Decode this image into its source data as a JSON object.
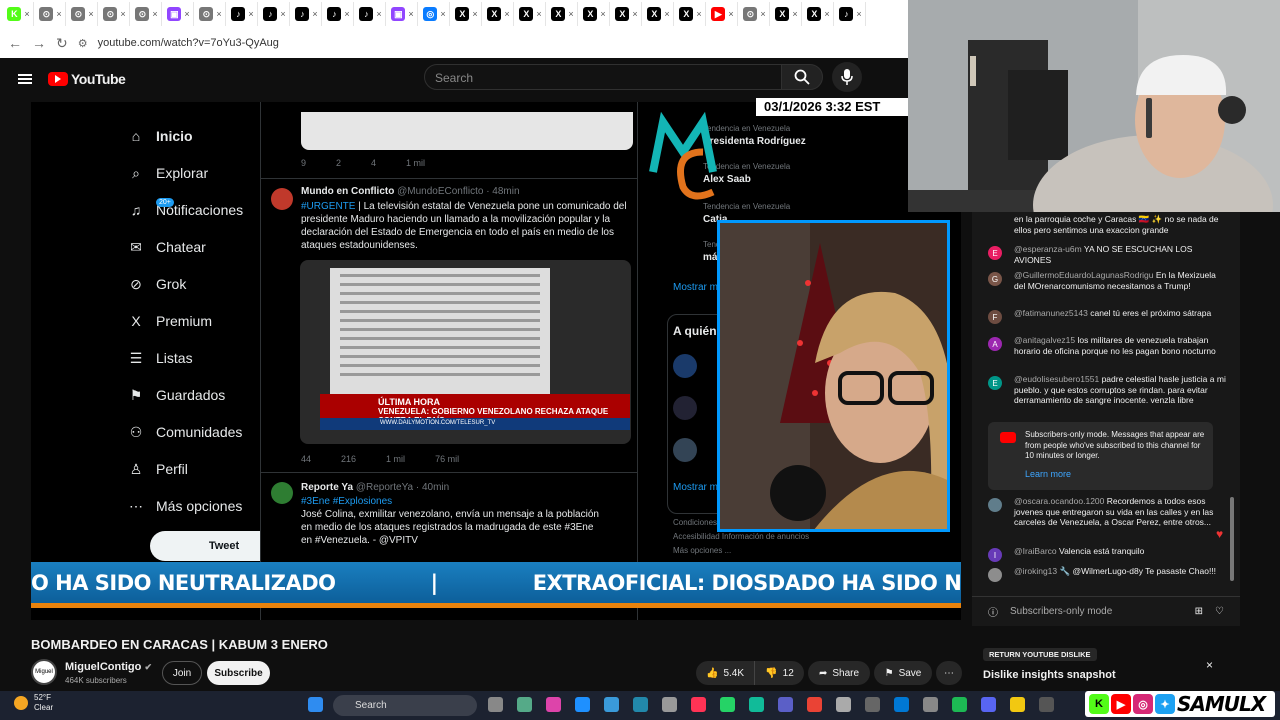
{
  "browser": {
    "tabs": [
      {
        "icon": "kick-icon",
        "color": "#53fc18",
        "letter": "K"
      },
      {
        "icon": "chrome-icon",
        "color": "#777",
        "letter": "⊙"
      },
      {
        "icon": "chrome-icon",
        "color": "#777",
        "letter": "⊙"
      },
      {
        "icon": "chrome-icon",
        "color": "#777",
        "letter": "⊙"
      },
      {
        "icon": "chrome-icon",
        "color": "#777",
        "letter": "⊙"
      },
      {
        "icon": "twitch-icon",
        "color": "#9146ff",
        "letter": "▣"
      },
      {
        "icon": "chrome-icon",
        "color": "#777",
        "letter": "⊙"
      },
      {
        "icon": "tiktok-icon",
        "color": "#000",
        "letter": "♪"
      },
      {
        "icon": "tiktok-icon",
        "color": "#000",
        "letter": "♪"
      },
      {
        "icon": "tiktok-icon",
        "color": "#000",
        "letter": "♪"
      },
      {
        "icon": "tiktok-icon",
        "color": "#000",
        "letter": "♪"
      },
      {
        "icon": "tiktok-icon",
        "color": "#000",
        "letter": "♪"
      },
      {
        "icon": "twitch-icon",
        "color": "#9146ff",
        "letter": "▣"
      },
      {
        "icon": "messenger-icon",
        "color": "#0a7cff",
        "letter": "◎"
      },
      {
        "icon": "x-icon",
        "color": "#000",
        "letter": "X"
      },
      {
        "icon": "x-icon",
        "color": "#000",
        "letter": "X"
      },
      {
        "icon": "x-icon",
        "color": "#000",
        "letter": "X"
      },
      {
        "icon": "x-icon",
        "color": "#000",
        "letter": "X"
      },
      {
        "icon": "x-icon",
        "color": "#000",
        "letter": "X"
      },
      {
        "icon": "x-icon",
        "color": "#000",
        "letter": "X"
      },
      {
        "icon": "x-icon",
        "color": "#000",
        "letter": "X"
      },
      {
        "icon": "x-icon",
        "color": "#000",
        "letter": "X"
      },
      {
        "icon": "youtube-icon",
        "color": "#f00",
        "letter": "▶"
      },
      {
        "icon": "chrome-icon",
        "color": "#777",
        "letter": "⊙"
      },
      {
        "icon": "x-icon",
        "color": "#000",
        "letter": "X"
      },
      {
        "icon": "x-icon",
        "color": "#000",
        "letter": "X"
      },
      {
        "icon": "tiktok-icon",
        "color": "#000",
        "letter": "♪"
      }
    ],
    "url": "youtube.com/watch?v=7oYu3-QyAug"
  },
  "youtube": {
    "logo_text": "YouTube",
    "search_placeholder": "Search"
  },
  "video": {
    "x_nav": [
      {
        "icon": "home-icon",
        "glyph": "⌂",
        "label": "Inicio",
        "bold": true
      },
      {
        "icon": "search-icon",
        "glyph": "⌕",
        "label": "Explorar"
      },
      {
        "icon": "bell-icon",
        "glyph": "♫",
        "label": "Notificaciones"
      },
      {
        "icon": "mail-icon",
        "glyph": "✉",
        "label": "Chatear"
      },
      {
        "icon": "grok-icon",
        "glyph": "⊘",
        "label": "Grok"
      },
      {
        "icon": "x-icon",
        "glyph": "X",
        "label": "Premium"
      },
      {
        "icon": "list-icon",
        "glyph": "☰",
        "label": "Listas"
      },
      {
        "icon": "bookmark-icon",
        "glyph": "⚑",
        "label": "Guardados"
      },
      {
        "icon": "people-icon",
        "glyph": "⚇",
        "label": "Comunidades"
      },
      {
        "icon": "person-icon",
        "glyph": "♙",
        "label": "Perfil"
      },
      {
        "icon": "more-icon",
        "glyph": "⋯",
        "label": "Más opciones"
      }
    ],
    "notif_badge": "20+",
    "tweet_button": "Tweet",
    "tweet0_actions": [
      "9",
      "2",
      "4",
      "1 mil"
    ],
    "tweet1": {
      "name": "Mundo en Conflicto",
      "handle": "@MundoEConflicto · 48min",
      "hashtag": "#URGENTE",
      "text": "| La televisión estatal de Venezuela pone un comunicado del presidente Maduro haciendo un llamado a la movilización popular y la declaración del Estado de Emergencia en todo el país en medio de los ataques estadounidenses.",
      "banner_label": "ÚLTIMA HORA",
      "banner_text": "VENEZUELA: GOBIERNO VENEZOLANO RECHAZA ATAQUE CONTRA EL PAÍS",
      "strip": "WWW.DAILYMOTION.COM/TELESUR_TV",
      "actions": [
        "44",
        "216",
        "1 mil",
        "76 mil"
      ]
    },
    "tweet2": {
      "name": "Reporte Ya",
      "handle": "@ReporteYa · 40min",
      "hashtags": "#3Ene #Explosiones",
      "text": "José Colina, exmilitar venezolano, envía un mensaje a la población en medio de los ataques registrados la madrugada de este #3Ene en #Venezuela. - @VPITV"
    },
    "trends": [
      {
        "small": "Tendencia en Venezuela",
        "big": "Presidenta Rodríguez"
      },
      {
        "small": "Tendencia en Venezuela",
        "big": "Alex Saab"
      },
      {
        "small": "Tendencia en Venezuela",
        "big": "Catia"
      },
      {
        "small": "Tendencia",
        "big": "más de 1..."
      }
    ],
    "mostrar": "Mostrar m...",
    "aquien": "A quién",
    "footer_links": "Condiciones de... Política de cookies Accesibilidad Información de anuncios Más opciones ...",
    "datetime": "03/1/2026 3:32 EST",
    "ticker_left": "O HA SIDO NEUTRALIZADO",
    "ticker_divider": "|",
    "ticker_right": "EXTRAOFICIAL: DIOSDADO HA SIDO NEUTRALIZADO"
  },
  "meta": {
    "title": "BOMBARDEO EN CARACAS | KABUM 3 ENERO",
    "channel": "MiguelContigo",
    "avatar_text": "Miguel",
    "subscribers": "464K subscribers",
    "join": "Join",
    "subscribe": "Subscribe",
    "likes": "5.4K",
    "dislikes": "12",
    "share": "Share",
    "save": "Save"
  },
  "chat": {
    "messages": [
      {
        "author": "",
        "text": "en la parroquia coche y Caracas 🇻🇪 ✨ no se nada de ellos pero sentimos una exaccion grande",
        "avatar": "",
        "color": "#e91e63"
      },
      {
        "author": "@esperanza-u6m",
        "text": "YA NO SE ESCUCHAN LOS AVIONES",
        "avatar": "E",
        "color": "#e91e63"
      },
      {
        "author": "@GuillermoEduardoLagunasRodrigu",
        "text": "En la Mexizuela del MOrenarcomunismo necesitamos a Trump!",
        "avatar": "G",
        "color": "#795548"
      },
      {
        "author": "@fatimanunez5143",
        "text": "canel tú eres el próximo sátrapa",
        "avatar": "F",
        "color": "#6d4c41"
      },
      {
        "author": "@anitagalvez15",
        "text": "los militares de venezuela trabajan horario de oficina porque no les pagan bono nocturno",
        "avatar": "A",
        "color": "#9c27b0"
      },
      {
        "author": "@eudolisesubero1551",
        "text": "padre celestial hasle justicia a mi pueblo. y que estos corruptos se rindan. para evitar derramamiento de sangre inocente. venzla libre",
        "avatar": "E",
        "color": "#009688"
      },
      {
        "author": "@oscara.ocandoo.1200",
        "text": "Recordemos a todos esos jovenes que entregaron su vida en las calles y en las carceles de Venezuela, a Oscar Perez, entre otros...",
        "avatar": "",
        "color": "#607d8b"
      },
      {
        "author": "@IraiBarco",
        "text": "Valencia está tranquilo",
        "avatar": "I",
        "color": "#673ab7"
      },
      {
        "author": "@iroking13 🔧",
        "text": "@WilmerLugo-d8y Te pasaste Chao!!!",
        "avatar": "",
        "color": "#8d8d8d"
      }
    ],
    "notice": "Subscribers-only mode. Messages that appear are from people who've subscribed to this channel for 10 minutes or longer.",
    "learn_more": "Learn more",
    "footer": "Subscribers-only mode"
  },
  "ryd": {
    "tag": "RETURN YOUTUBE DISLIKE",
    "title": "Dislike insights snapshot",
    "close": "×"
  },
  "taskbar": {
    "temp": "52°F",
    "cond": "Clear",
    "search": "Search",
    "brand": "SAMULX",
    "kick_letter": "K"
  }
}
